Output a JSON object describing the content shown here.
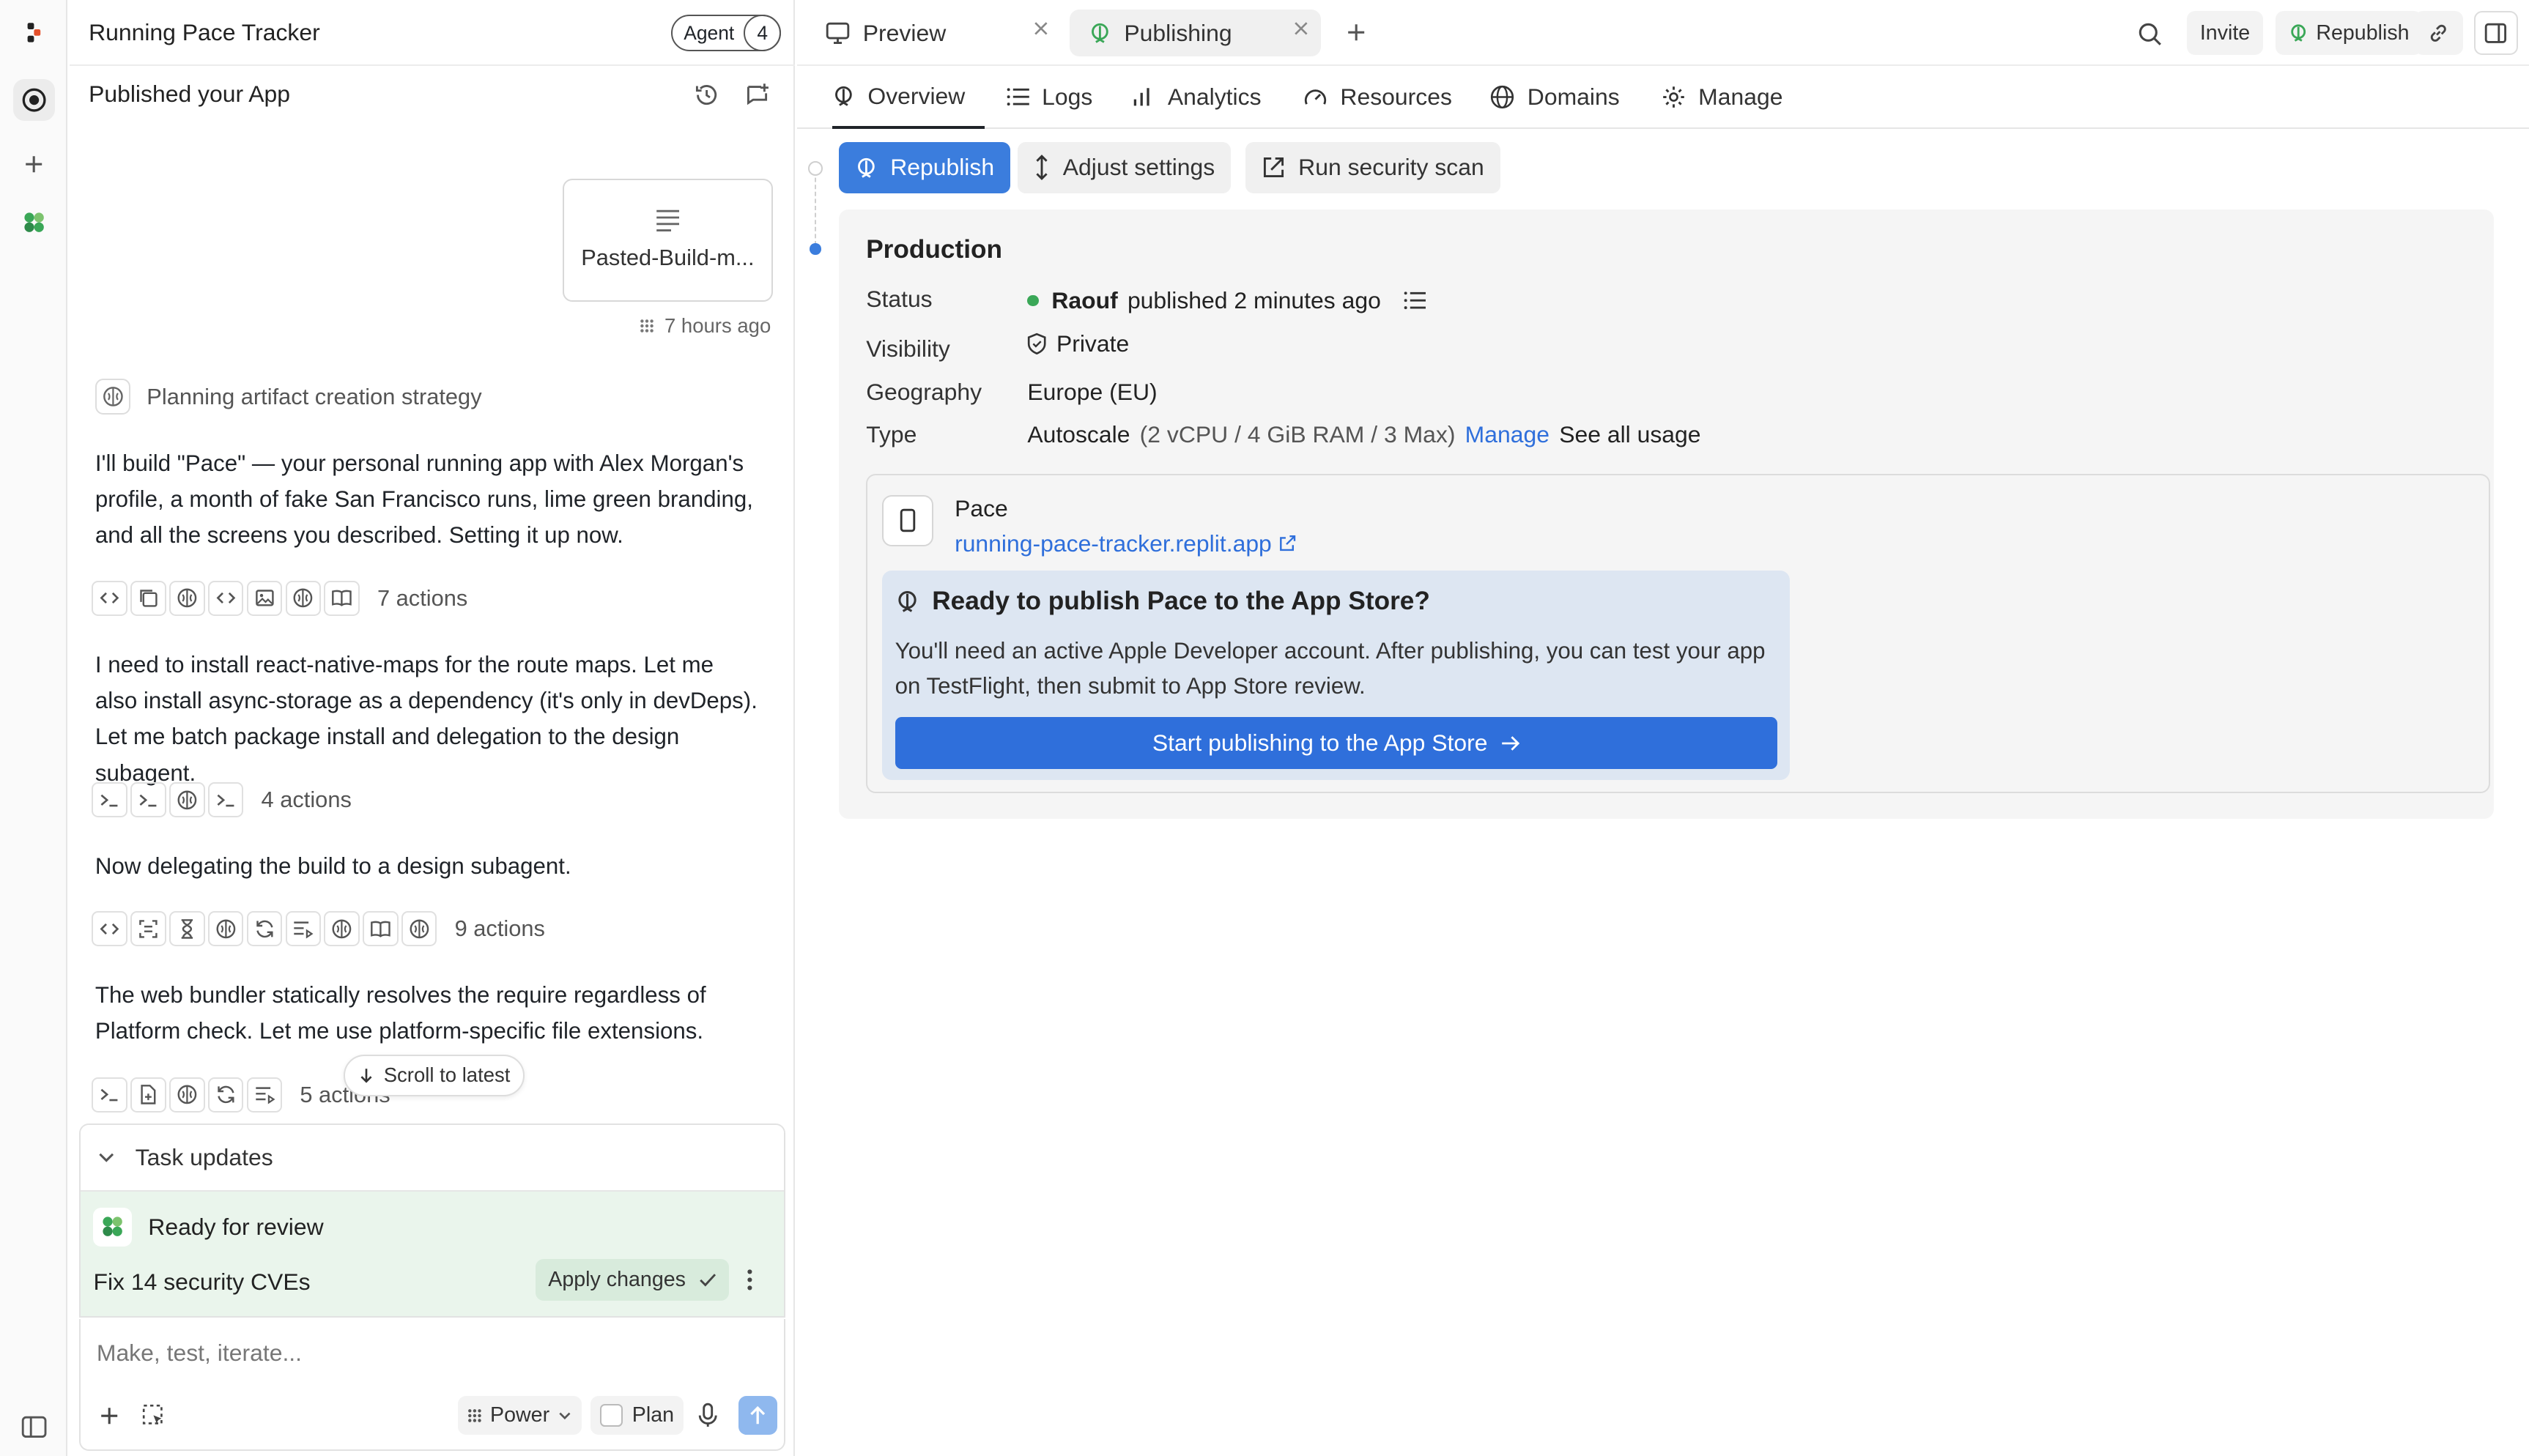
{
  "chat": {
    "app_title": "Running Pace Tracker",
    "agent_label": "Agent",
    "agent_count": "4",
    "sub_title": "Published your App",
    "attachment_name": "Pasted-Build-m...",
    "attachment_time": "7 hours ago",
    "planning_text": "Planning artifact creation strategy",
    "messages": [
      "I'll build \"Pace\" — your personal running app with Alex Morgan's profile, a month of fake San Francisco runs, lime green branding, and all the screens you described. Setting it up now.",
      "I need to install react-native-maps for the route maps. Let me also install async-storage as a dependency (it's only in devDeps). Let me batch package install and delegation to the design subagent.",
      "Now delegating the build to a design subagent.",
      "The web bundler statically resolves the require regardless of Platform check. Let me use platform-specific file extensions."
    ],
    "action_groups": [
      {
        "icons": [
          "code-icon",
          "copy-icon",
          "brain-icon",
          "code-icon",
          "image-icon",
          "brain-icon",
          "book-icon"
        ],
        "label": "7 actions"
      },
      {
        "icons": [
          "terminal-icon",
          "terminal-icon",
          "brain-icon",
          "terminal-icon"
        ],
        "label": "4 actions"
      },
      {
        "icons": [
          "code-icon",
          "scan-icon",
          "hourglass-icon",
          "brain-icon",
          "refresh-icon",
          "list-play-icon",
          "brain-icon",
          "book-icon",
          "brain-icon"
        ],
        "label": "9 actions"
      },
      {
        "icons": [
          "terminal-icon",
          "file-plus-icon",
          "brain-icon",
          "refresh-icon",
          "list-play-icon"
        ],
        "label": "5 actions"
      }
    ],
    "scroll_latest": "Scroll to latest",
    "task_updates": "Task updates",
    "ready_for_review": "Ready for review",
    "task_name": "Fix 14 security CVEs",
    "apply_changes": "Apply changes",
    "composer_placeholder": "Make, test, iterate...",
    "power_label": "Power",
    "plan_label": "Plan"
  },
  "topbar": {
    "tabs": [
      {
        "label": "Preview",
        "icon": "monitor-icon"
      },
      {
        "label": "Publishing",
        "icon": "rocket-icon",
        "active": true
      }
    ],
    "invite": "Invite",
    "republish": "Republish"
  },
  "subnav": {
    "items": [
      {
        "label": "Overview",
        "icon": "rocket-icon",
        "active": true
      },
      {
        "label": "Logs",
        "icon": "list-icon"
      },
      {
        "label": "Analytics",
        "icon": "bar-chart-icon"
      },
      {
        "label": "Resources",
        "icon": "gauge-icon"
      },
      {
        "label": "Domains",
        "icon": "globe-icon"
      },
      {
        "label": "Manage",
        "icon": "gear-icon"
      }
    ]
  },
  "publishing": {
    "republish": "Republish",
    "adjust_settings": "Adjust settings",
    "run_security_scan": "Run security scan",
    "production_title": "Production",
    "labels": {
      "status": "Status",
      "visibility": "Visibility",
      "geography": "Geography",
      "type": "Type"
    },
    "status_user": "Raouf",
    "status_text": "published 2 minutes ago",
    "visibility": "Private",
    "geography": "Europe (EU)",
    "type_name": "Autoscale",
    "type_detail": "(2 vCPU / 4 GiB RAM / 3 Max)",
    "manage_link": "Manage",
    "usage_link": "See all usage",
    "app_name": "Pace",
    "app_url": "running-pace-tracker.replit.app",
    "appstore_title": "Ready to publish Pace to the App Store?",
    "appstore_desc": "You'll need an active Apple Developer account. After publishing, you can test your app on TestFlight, then submit to App Store review.",
    "appstore_button": "Start publishing to the App Store"
  },
  "colors": {
    "accent": "#3b7ddd",
    "link": "#2f6fdb",
    "status_green": "#3aa757",
    "review_bg": "#eaf5ec",
    "appstore_bg": "#dde6f2"
  }
}
